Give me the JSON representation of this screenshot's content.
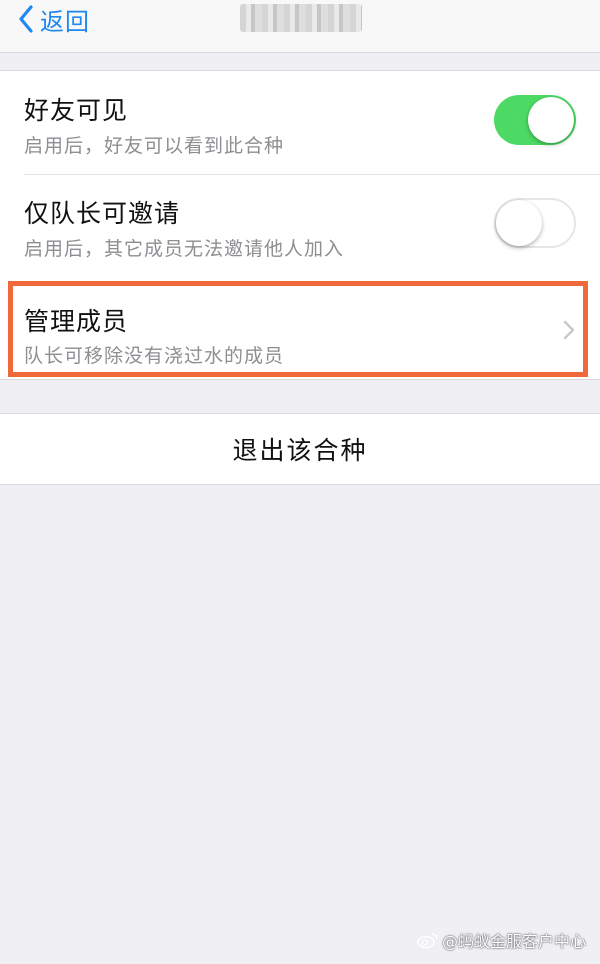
{
  "colors": {
    "accent": "#1f87f0",
    "toggle_on": "#4cd964",
    "highlight": "#f0693a",
    "background": "#efeff4"
  },
  "navbar": {
    "back_label": "返回",
    "back_icon": "chevron-left-icon",
    "title": ""
  },
  "settings": [
    {
      "title": "好友可见",
      "subtitle": "启用后，好友可以看到此合种",
      "control": "toggle",
      "enabled": true
    },
    {
      "title": "仅队长可邀请",
      "subtitle": "启用后，其它成员无法邀请他人加入",
      "control": "toggle",
      "enabled": false
    },
    {
      "title": "管理成员",
      "subtitle": "队长可移除没有浇过水的成员",
      "control": "disclosure",
      "icon": "chevron-right-icon"
    }
  ],
  "exit": {
    "label": "退出该合种"
  },
  "watermark": {
    "text": "@蚂蚁金服客户中心",
    "icon": "weibo-icon"
  }
}
